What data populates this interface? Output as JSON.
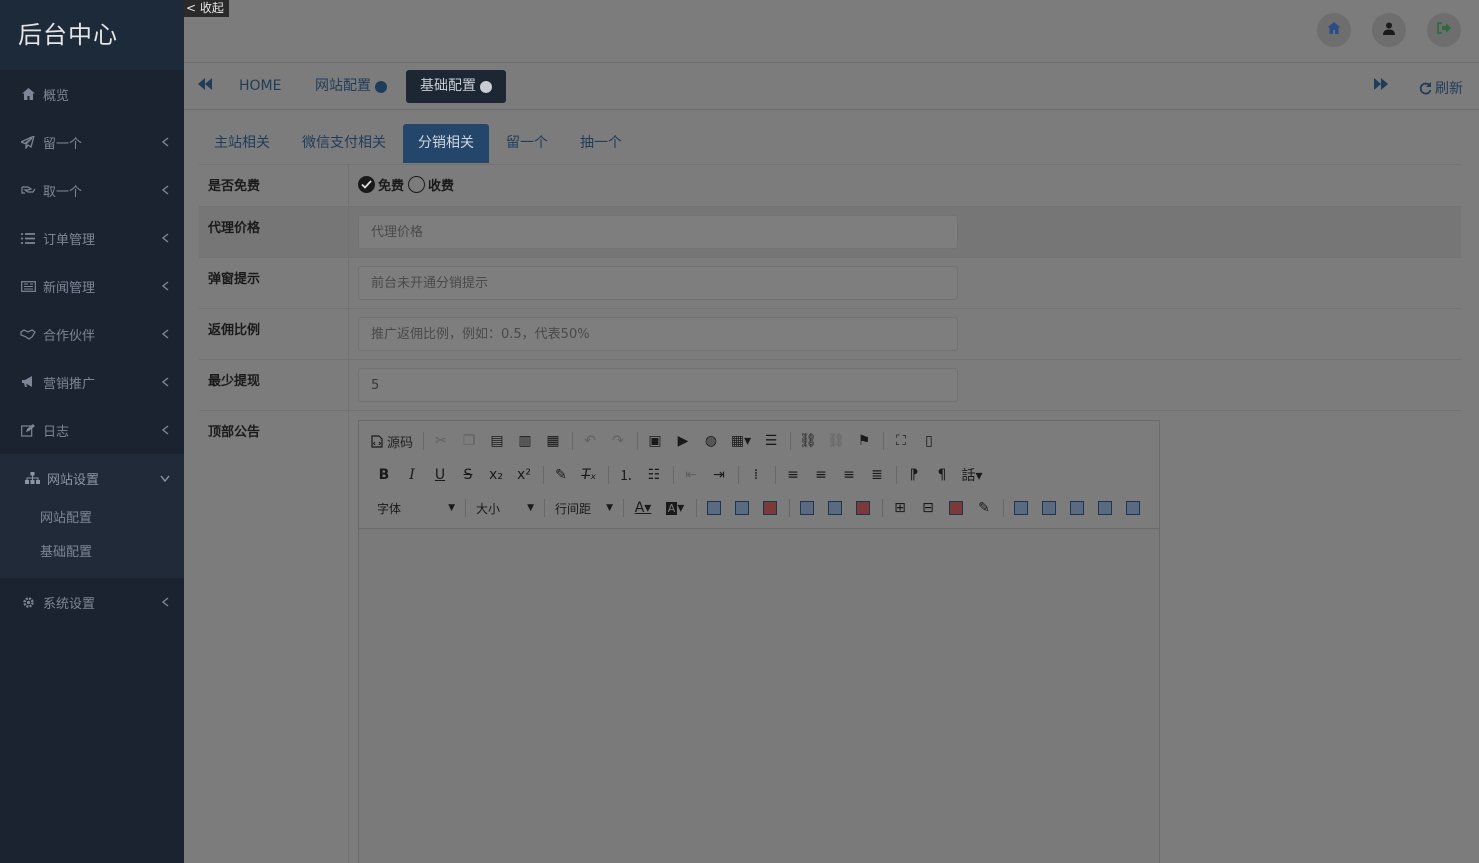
{
  "brand": "后台中心",
  "collapse_label": "< 收起",
  "sidebar": {
    "items": [
      {
        "label": "概览",
        "icon": "home-icon"
      },
      {
        "label": "留一个",
        "icon": "send-icon"
      },
      {
        "label": "取一个",
        "icon": "hand-icon"
      },
      {
        "label": "订单管理",
        "icon": "list-icon"
      },
      {
        "label": "新闻管理",
        "icon": "newspaper-icon"
      },
      {
        "label": "合作伙伴",
        "icon": "handshake-icon"
      },
      {
        "label": "营销推广",
        "icon": "bullhorn-icon"
      },
      {
        "label": "日志",
        "icon": "edit-icon"
      },
      {
        "label": "网站设置",
        "icon": "sitemap-icon"
      },
      {
        "label": "系统设置",
        "icon": "gear-icon"
      }
    ],
    "sub_items": [
      "网站配置",
      "基础配置"
    ]
  },
  "page_tabs": [
    "HOME",
    "网站配置",
    "基础配置"
  ],
  "refresh_label": "刷新",
  "sub_tabs": [
    "主站相关",
    "微信支付相关",
    "分销相关",
    "留一个",
    "抽一个"
  ],
  "form": {
    "free": {
      "label": "是否免费",
      "opt_free": "免费",
      "opt_paid": "收费"
    },
    "agent_price": {
      "label": "代理价格",
      "placeholder": "代理价格",
      "value": ""
    },
    "popup_tip": {
      "label": "弹窗提示",
      "placeholder": "前台未开通分销提示",
      "value": ""
    },
    "rebate": {
      "label": "返佣比例",
      "placeholder": "推广返佣比例，例如：0.5，代表50%",
      "value": ""
    },
    "min_withdraw": {
      "label": "最少提现",
      "placeholder": "",
      "value": "5"
    },
    "notice": {
      "label": "顶部公告"
    }
  },
  "editor": {
    "source_label": "源码",
    "font_label": "字体",
    "size_label": "大小",
    "lineheight_label": "行间距"
  }
}
